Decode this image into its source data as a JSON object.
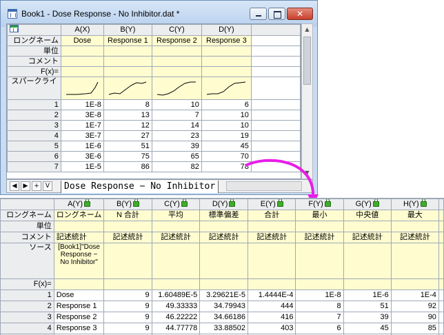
{
  "window1": {
    "title": "Book1 - Dose Response - No Inhibitor.dat *",
    "buttons": {
      "minimize": "minimize",
      "maximize": "maximize",
      "close": "✕"
    },
    "columns": [
      {
        "header": "A(X)",
        "longname": "Dose"
      },
      {
        "header": "B(Y)",
        "longname": "Response 1"
      },
      {
        "header": "C(Y)",
        "longname": "Response 2"
      },
      {
        "header": "D(Y)",
        "longname": "Response 3"
      }
    ],
    "row_labels": {
      "longname": "ロングネーム",
      "unit": "単位",
      "comment": "コメント",
      "fx": "F(x)=",
      "sparkline": "スパークライ"
    },
    "rows": [
      {
        "index": "1",
        "cells": [
          "1E-8",
          "8",
          "10",
          "6"
        ]
      },
      {
        "index": "2",
        "cells": [
          "3E-8",
          "13",
          "7",
          "10"
        ]
      },
      {
        "index": "3",
        "cells": [
          "1E-7",
          "12",
          "14",
          "10"
        ]
      },
      {
        "index": "4",
        "cells": [
          "3E-7",
          "27",
          "23",
          "19"
        ]
      },
      {
        "index": "5",
        "cells": [
          "1E-6",
          "51",
          "39",
          "45"
        ]
      },
      {
        "index": "6",
        "cells": [
          "3E-6",
          "75",
          "65",
          "70"
        ]
      },
      {
        "index": "7",
        "cells": [
          "1E-5",
          "86",
          "82",
          "78"
        ]
      }
    ],
    "sheet_tab": "Dose Response − No Inhibitor",
    "nav_buttons": [
      "◀",
      "▶",
      "+",
      "V"
    ]
  },
  "arrow_color": "#e81ee8",
  "window2": {
    "columns": [
      {
        "header": "A(Y)",
        "longname": "ロングネーム",
        "comment": "記述統計"
      },
      {
        "header": "B(Y)",
        "longname": "N 合計",
        "comment": "記述統計"
      },
      {
        "header": "C(Y)",
        "longname": "平均",
        "comment": "記述統計"
      },
      {
        "header": "D(Y)",
        "longname": "標準偏差",
        "comment": "記述統計"
      },
      {
        "header": "E(Y)",
        "longname": "合計",
        "comment": "記述統計"
      },
      {
        "header": "F(Y)",
        "longname": "最小",
        "comment": "記述統計"
      },
      {
        "header": "G(Y)",
        "longname": "中央値",
        "comment": "記述統計"
      },
      {
        "header": "H(Y)",
        "longname": "最大",
        "comment": "記述統計"
      }
    ],
    "row_labels": {
      "longname": "ロングネーム",
      "unit": "単位",
      "comment": "コメント",
      "source": "ソース",
      "fx": "F(x)="
    },
    "source_text": "[Book1]\"Dose Response − No Inhibitor\"",
    "rows": [
      {
        "index": "1",
        "cells": [
          "Dose",
          "9",
          "1.60489E-5",
          "3.29621E-5",
          "1.4444E-4",
          "1E-8",
          "1E-6",
          "1E-4"
        ]
      },
      {
        "index": "2",
        "cells": [
          "Response 1",
          "9",
          "49.33333",
          "34.79943",
          "444",
          "8",
          "51",
          "92"
        ]
      },
      {
        "index": "3",
        "cells": [
          "Response 2",
          "9",
          "46.22222",
          "34.66186",
          "416",
          "7",
          "39",
          "90"
        ]
      },
      {
        "index": "4",
        "cells": [
          "Response 3",
          "9",
          "44.77778",
          "33.88502",
          "403",
          "6",
          "45",
          "85"
        ]
      }
    ]
  }
}
